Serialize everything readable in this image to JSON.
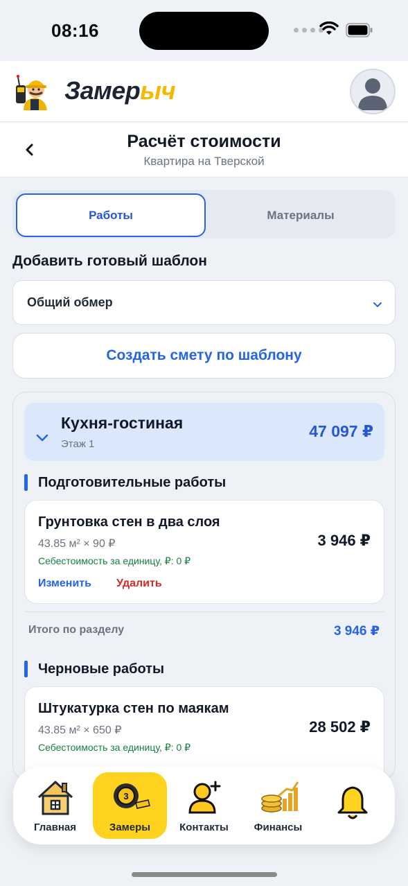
{
  "status_bar": {
    "time": "08:16"
  },
  "app": {
    "logo_part1": "Замер",
    "logo_part2": "ыч",
    "logo_icon": "mascot-logo-icon",
    "avatar_icon": "user-icon"
  },
  "header": {
    "title": "Расчёт стоимости",
    "subtitle": "Квартира на Тверской",
    "back_icon": "chevron-left-icon"
  },
  "tabs": [
    {
      "label": "Работы",
      "active": true
    },
    {
      "label": "Материалы",
      "active": false
    }
  ],
  "template": {
    "label": "Добавить готовый шаблон",
    "selected": "Общий обмер",
    "create_button": "Создать смету по шаблону"
  },
  "room": {
    "title": "Кухня-гостиная",
    "floor": "Этаж 1",
    "total": "47 097 ₽",
    "sections": [
      {
        "title": "Подготовительные работы",
        "items": [
          {
            "name": "Грунтовка стен в два слоя",
            "qty": "43.85 м² × 90 ₽",
            "cost": "Себестоимость за единицу, ₽: 0 ₽",
            "price": "3 946 ₽",
            "edit": "Изменить",
            "delete": "Удалить"
          }
        ],
        "subtotal_label": "Итого по разделу",
        "subtotal": "3 946 ₽"
      },
      {
        "title": "Черновые работы",
        "items": [
          {
            "name": "Штукатурка стен по маякам",
            "qty": "43.85 м² × 650 ₽",
            "cost": "Себестоимость за единицу, ₽: 0 ₽",
            "price": "28 502 ₽"
          }
        ]
      }
    ]
  },
  "bottom_nav": [
    {
      "label": "Главная",
      "icon": "house-icon",
      "active": false
    },
    {
      "label": "Замеры",
      "icon": "tape-measure-icon",
      "active": true
    },
    {
      "label": "Контакты",
      "icon": "add-contact-icon",
      "active": false
    },
    {
      "label": "Финансы",
      "icon": "coins-chart-icon",
      "active": false
    },
    {
      "label": "",
      "icon": "bell-icon",
      "active": false
    }
  ],
  "colors": {
    "accent": "#2563eb",
    "yellow": "#ffd21f",
    "danger": "#dc2626",
    "success": "#15803d"
  }
}
